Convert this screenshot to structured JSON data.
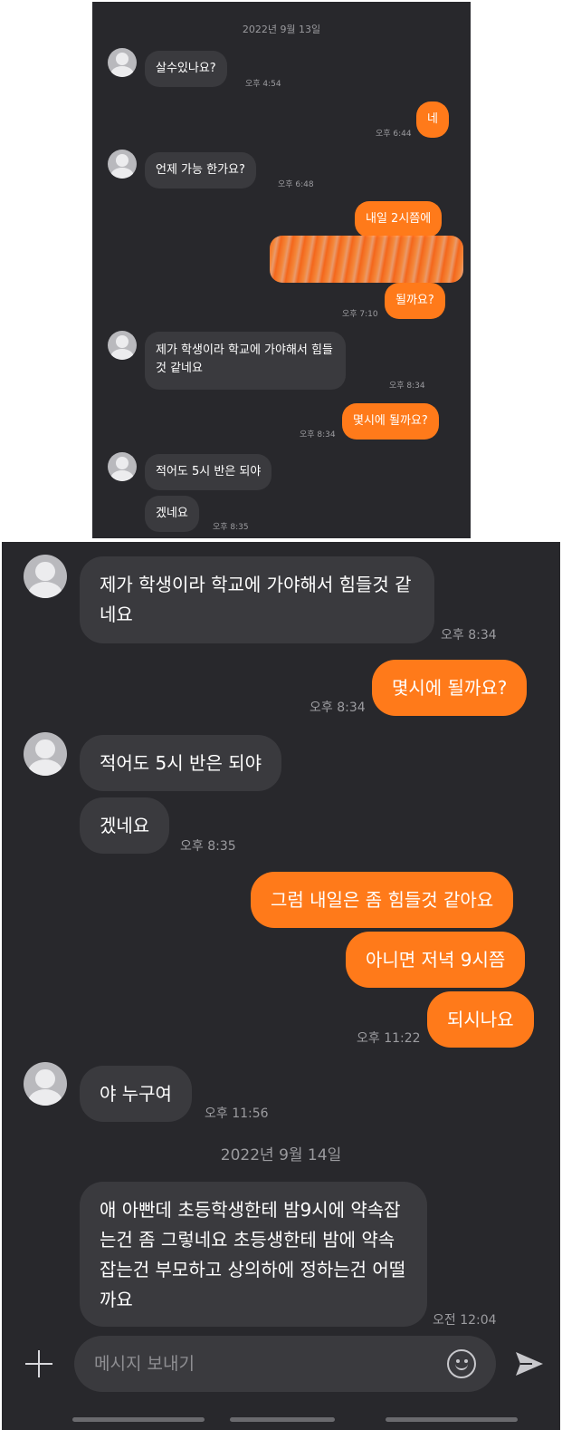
{
  "panel1": {
    "date": "2022년 9월 13일",
    "messages": [
      {
        "text": "살수있나요?",
        "time": "오후 4:54"
      },
      {
        "text": "네",
        "time": "오후 6:44"
      },
      {
        "text": "언제 가능 한가요?",
        "time": "오후 6:48"
      },
      {
        "text": "내일 2시쯤에"
      },
      {
        "text": "될까요?",
        "time": "오후 7:10"
      },
      {
        "text": "제가 학생이라 학교에 가야해서 힘들것 같네요",
        "time": "오후 8:34"
      },
      {
        "text": "몇시에 될까요?",
        "time": "오후 8:34"
      },
      {
        "text": "적어도 5시 반은 되야"
      },
      {
        "text": "겠네요",
        "time": "오후 8:35"
      }
    ]
  },
  "panel2": {
    "messages": [
      {
        "text": "제가 학생이라 학교에 가야해서 힘들것 같네요",
        "time": "오후 8:34"
      },
      {
        "text": "몇시에 될까요?",
        "time": "오후 8:34"
      },
      {
        "text": "적어도 5시 반은 되야"
      },
      {
        "text": "겠네요",
        "time": "오후 8:35"
      },
      {
        "text": "그럼 내일은 좀 힘들것 같아요"
      },
      {
        "text": "아니면 저녁 9시쯤"
      },
      {
        "text": "되시나요",
        "time": "오후 11:22"
      },
      {
        "text": "야 누구여",
        "time": "오후 11:56"
      },
      {
        "text": "애 아빤데 초등학생한테 밤9시에 약속잡는건 좀 그렇네요 초등생한테 밤에 약속잡는건 부모하고 상의하에 정하는건 어떨까요",
        "time": "오전 12:04"
      }
    ],
    "date": "2022년 9월 14일",
    "input_placeholder": "메시지 보내기"
  },
  "colors": {
    "background": "#28282c",
    "incoming_bubble": "#3a3a3e",
    "outgoing_bubble": "#ff7a1a"
  },
  "icons": [
    "avatar-icon",
    "plus-icon",
    "emoji-icon",
    "send-icon"
  ]
}
